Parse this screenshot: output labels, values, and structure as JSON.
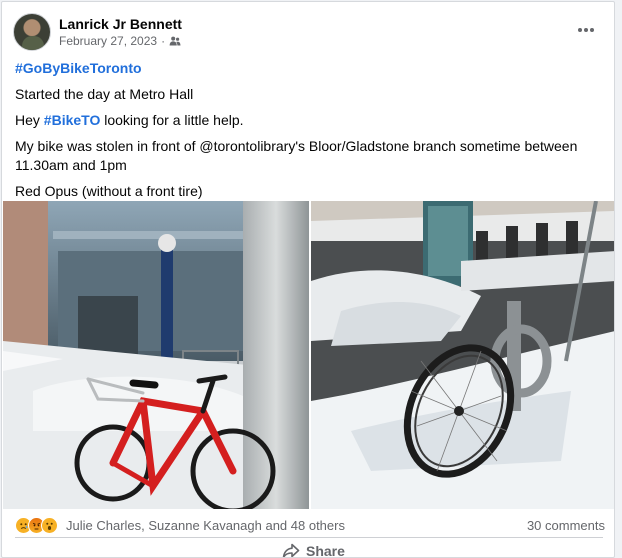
{
  "post": {
    "author": "Lanrick Jr Bennett",
    "date": "February 27, 2023",
    "separator": "·",
    "audience_icon": "friends-icon",
    "more_icon": "more-horizontal-icon",
    "hashtag_line": "#GoByBikeToronto",
    "line1": "Started the day at Metro Hall",
    "line2_pre": "Hey ",
    "line2_tag": "#BikeTO",
    "line2_post": " looking for a little help.",
    "line3": "My bike was stolen in front of @torontolibrary's Bloor/Gladstone branch sometime between 11.30am and 1pm",
    "line4": "Red Opus (without a front tire)"
  },
  "photos": [
    {
      "name": "red-bike-photo",
      "icon": "photo"
    },
    {
      "name": "locked-wheel-photo",
      "icon": "photo"
    }
  ],
  "footer": {
    "reactions": [
      "sad",
      "angry",
      "wow"
    ],
    "reactors": "Julie Charles, Suzanne Kavanagh and 48 others",
    "comments": "30 comments",
    "share_label": "Share",
    "share_icon": "share-icon"
  },
  "colors": {
    "link": "#216fdb",
    "muted": "#65676b",
    "bike_red": "#d41f1f"
  }
}
